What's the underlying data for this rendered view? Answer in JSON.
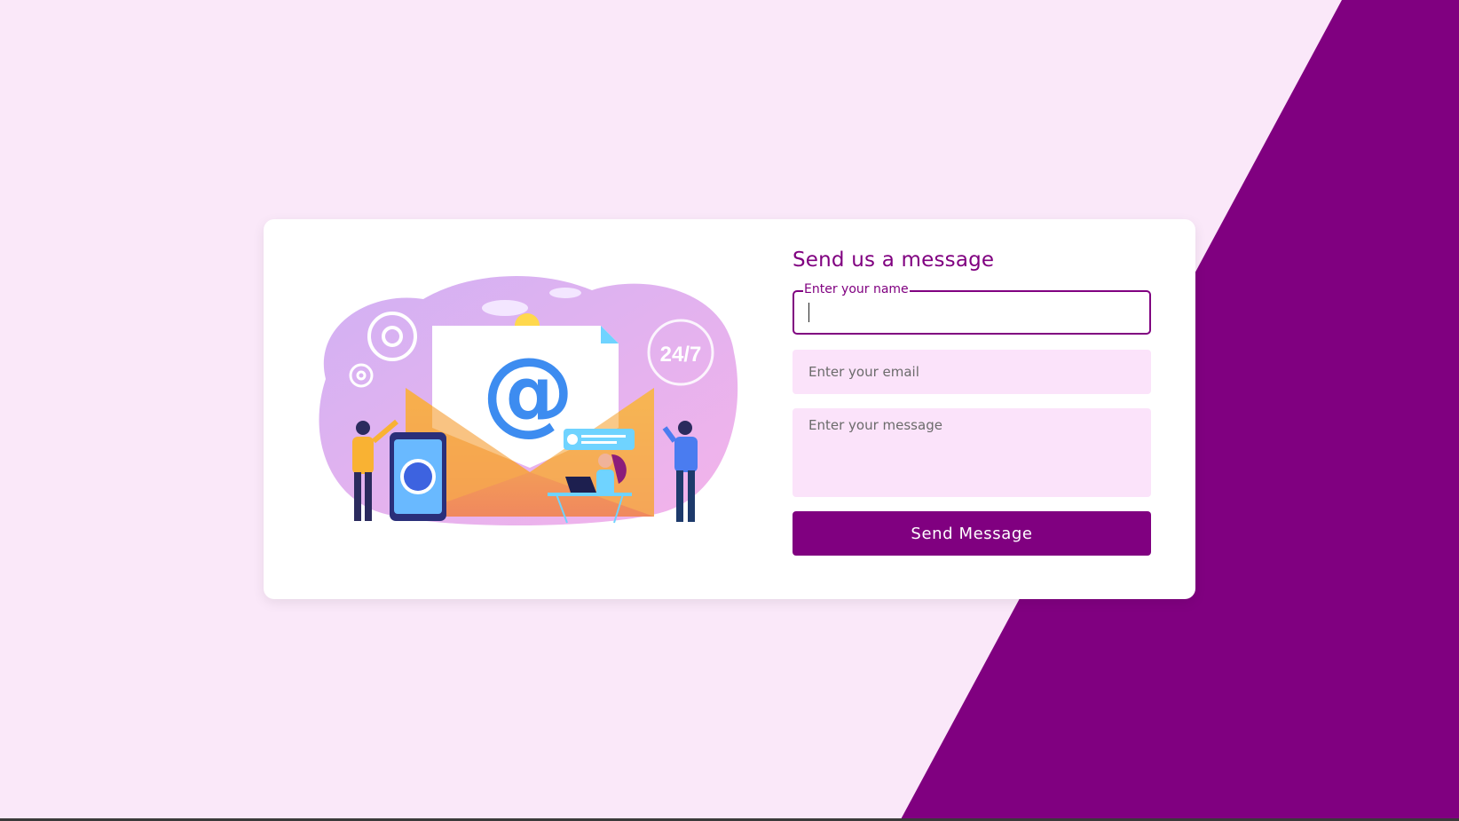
{
  "form": {
    "title": "Send us a message",
    "name_label": "Enter your name",
    "name_value": "",
    "email_placeholder": "Enter your email",
    "email_value": "",
    "message_placeholder": "Enter your message",
    "message_value": "",
    "submit_label": "Send Message"
  },
  "illustration": {
    "badge_text": "24/7",
    "at_symbol": "@"
  },
  "colors": {
    "accent": "#800080",
    "page_background": "#fae8f9",
    "input_background": "#fbe3fa",
    "card_background": "#ffffff"
  }
}
